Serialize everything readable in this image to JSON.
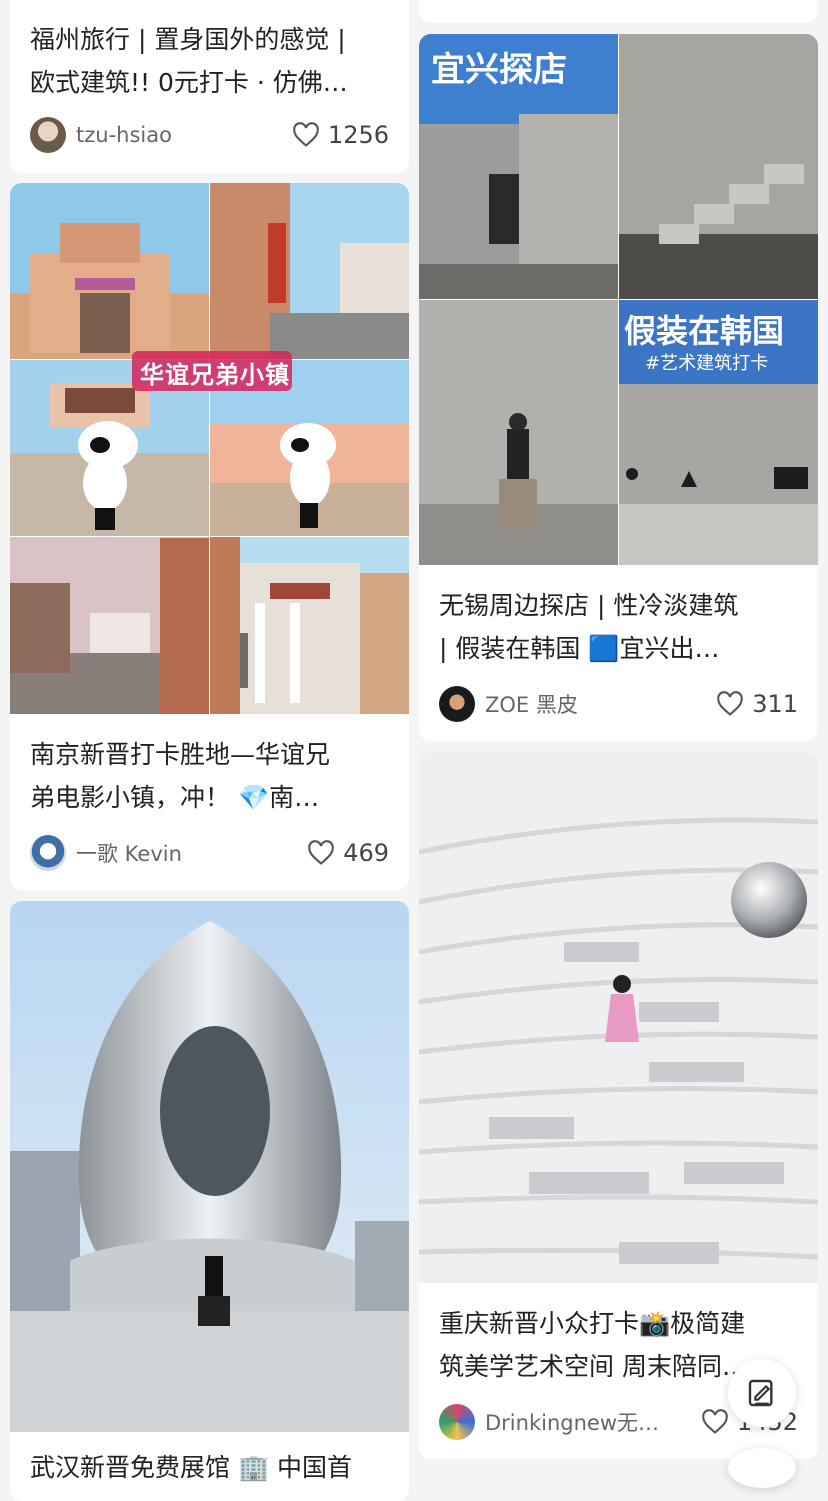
{
  "cards": [
    {
      "title_line1": "福州旅行 | 置身国外的感觉 |",
      "title_line2": "欧式建筑!! 0元打卡 · 仿佛…",
      "author": "tzu-hsiao",
      "likes": "1256"
    },
    {
      "overlay": "华谊兄弟小镇",
      "title_line1": "南京新晋打卡胜地—华谊兄",
      "title_line2": "弟电影小镇，冲！ 💎南…",
      "author": "一歌 Kevin",
      "likes": "469"
    },
    {
      "title_line1": "武汉新晋免费展馆 🏢 中国首",
      "title_line2": ""
    },
    {
      "overlay_top": "宜兴探店",
      "overlay_mid": "假装在韩国",
      "overlay_sub": "#艺术建筑打卡",
      "title_line1": "无锡周边探店 | 性冷淡建筑",
      "title_line2": "| 假装在韩国 🟦宜兴出…",
      "author": "ZOE 黑皮",
      "likes": "311"
    },
    {
      "title_line1": "重庆新晋小众打卡📸极简建",
      "title_line2": "筑美学艺术空间 周末陪同…",
      "author": "Drinkingnew无…",
      "likes": "1452"
    }
  ],
  "icons": {
    "like": "heart-outline-icon",
    "compose": "compose-note-icon"
  },
  "colors": {
    "background": "#f4f4f4",
    "card": "#ffffff",
    "text": "#222222",
    "muted": "#666666"
  }
}
